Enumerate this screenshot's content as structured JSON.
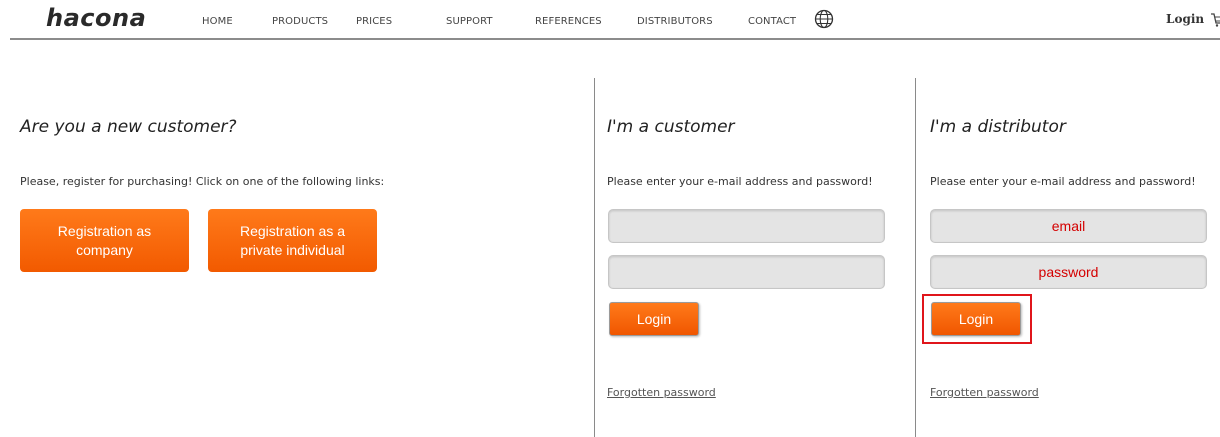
{
  "header": {
    "logo": "hacona",
    "nav": [
      "HOME",
      "PRODUCTS",
      "PRICES",
      "SUPPORT",
      "REFERENCES",
      "DISTRIBUTORS",
      "CONTACT"
    ],
    "login_label": "Login",
    "icons": {
      "language": "globe-icon",
      "cart": "cart-icon"
    }
  },
  "new_customer": {
    "heading": "Are you a new customer?",
    "text": "Please, register for purchasing! Click on one of the following links:",
    "btn_company_l1": "Registration as",
    "btn_company_l2": "company",
    "btn_private_l1": "Registration as a",
    "btn_private_l2": "private individual"
  },
  "customer": {
    "heading": "I'm a customer",
    "text": "Please enter your e-mail address and password!",
    "email_placeholder": "",
    "password_placeholder": "",
    "login_label": "Login",
    "forgot_label": "Forgotten password"
  },
  "distributor": {
    "heading": "I'm a distributor",
    "text": "Please enter your e-mail address and password!",
    "email_placeholder": "email",
    "password_placeholder": "password",
    "login_label": "Login",
    "forgot_label": "Forgotten password"
  },
  "colors": {
    "accent": "#f5620a",
    "highlight_box": "#e0151b"
  }
}
